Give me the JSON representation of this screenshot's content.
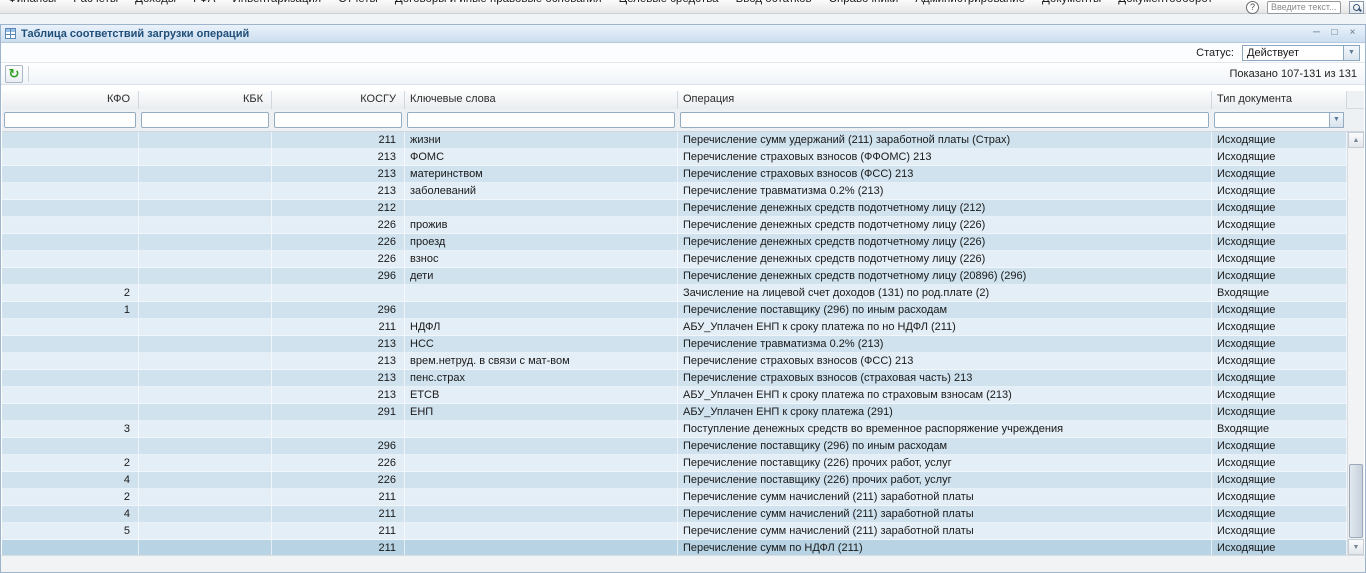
{
  "menu": {
    "items": [
      "Финансы",
      "Расчеты",
      "Доходы",
      "ГФА",
      "Инвентаризация",
      "Отчеты",
      "Договоры и иные правовые основания",
      "Целевые средства",
      "Ввод остатков",
      "Справочники",
      "Администрирование",
      "Документы",
      "Документооборот"
    ],
    "search_placeholder": "Введите текст...",
    "help_glyph": "?"
  },
  "window": {
    "title": "Таблица соответствий загрузки операций",
    "controls": {
      "minimize": "─",
      "maximize": "□",
      "close": "×"
    }
  },
  "status_bar": {
    "label": "Статус:",
    "value": "Действует"
  },
  "toolbar": {
    "pagination": "Показано 107-131 из 131"
  },
  "icons": {
    "refresh": "↻",
    "combo_arrow": "▼",
    "scroll_up": "▲",
    "scroll_down": "▼"
  },
  "grid": {
    "columns": [
      "КФО",
      "КБК",
      "КОСГУ",
      "Ключевые слова",
      "Операция",
      "Тип документа"
    ],
    "column_keys": [
      "kfo",
      "kbk",
      "kosgu",
      "keywords",
      "operation",
      "doctype"
    ],
    "selected_row_index": 24,
    "rows": [
      [
        "",
        "",
        "211",
        "жизни",
        "Перечисление сумм удержаний (211) заработной платы (Страх)",
        "Исходящие"
      ],
      [
        "",
        "",
        "213",
        "ФОМС",
        "Перечисление страховых взносов (ФФОМС) 213",
        "Исходящие"
      ],
      [
        "",
        "",
        "213",
        "материнством",
        "Перечисление страховых взносов (ФСС) 213",
        "Исходящие"
      ],
      [
        "",
        "",
        "213",
        "заболеваний",
        "Перечисление травматизма 0.2% (213)",
        "Исходящие"
      ],
      [
        "",
        "",
        "212",
        "",
        "Перечисление денежных средств подотчетному лицу (212)",
        "Исходящие"
      ],
      [
        "",
        "",
        "226",
        "прожив",
        "Перечисление денежных средств подотчетному лицу (226)",
        "Исходящие"
      ],
      [
        "",
        "",
        "226",
        "проезд",
        "Перечисление денежных средств подотчетному лицу (226)",
        "Исходящие"
      ],
      [
        "",
        "",
        "226",
        "взнос",
        "Перечисление денежных средств подотчетному лицу (226)",
        "Исходящие"
      ],
      [
        "",
        "",
        "296",
        "дети",
        "Перечисление денежных средств подотчетному лицу (20896) (296)",
        "Исходящие"
      ],
      [
        "2",
        "",
        "",
        "",
        "Зачисление на лицевой счет доходов (131) по род.плате (2)",
        "Входящие"
      ],
      [
        "1",
        "",
        "296",
        "",
        "Перечисление поставщику (296) по иным расходам",
        "Исходящие"
      ],
      [
        "",
        "",
        "211",
        "НДФЛ",
        "АБУ_Уплачен ЕНП к сроку платежа по но НДФЛ (211)",
        "Исходящие"
      ],
      [
        "",
        "",
        "213",
        "НСС",
        "Перечисление травматизма 0.2% (213)",
        "Исходящие"
      ],
      [
        "",
        "",
        "213",
        "врем.нетруд. в связи с мат-вом",
        "Перечисление страховых взносов (ФСС) 213",
        "Исходящие"
      ],
      [
        "",
        "",
        "213",
        "пенс.страх",
        "Перечисление страховых взносов (страховая часть) 213",
        "Исходящие"
      ],
      [
        "",
        "",
        "213",
        "ЕТСВ",
        "АБУ_Уплачен ЕНП к сроку платежа по страховым взносам (213)",
        "Исходящие"
      ],
      [
        "",
        "",
        "291",
        "ЕНП",
        "АБУ_Уплачен ЕНП к сроку платежа (291)",
        "Исходящие"
      ],
      [
        "3",
        "",
        "",
        "",
        "Поступление денежных средств во временное распоряжение учреждения",
        "Входящие"
      ],
      [
        "",
        "",
        "296",
        "",
        "Перечисление поставщику (296) по иным расходам",
        "Исходящие"
      ],
      [
        "2",
        "",
        "226",
        "",
        "Перечисление поставщику (226) прочих работ, услуг",
        "Исходящие"
      ],
      [
        "4",
        "",
        "226",
        "",
        "Перечисление поставщику (226) прочих работ, услуг",
        "Исходящие"
      ],
      [
        "2",
        "",
        "211",
        "",
        "Перечисление сумм начислений (211) заработной платы",
        "Исходящие"
      ],
      [
        "4",
        "",
        "211",
        "",
        "Перечисление сумм начислений (211) заработной платы",
        "Исходящие"
      ],
      [
        "5",
        "",
        "211",
        "",
        "Перечисление сумм начислений (211) заработной платы",
        "Исходящие"
      ],
      [
        "",
        "",
        "211",
        "",
        "Перечисление сумм по НДФЛ (211)",
        "Исходящие"
      ]
    ]
  }
}
